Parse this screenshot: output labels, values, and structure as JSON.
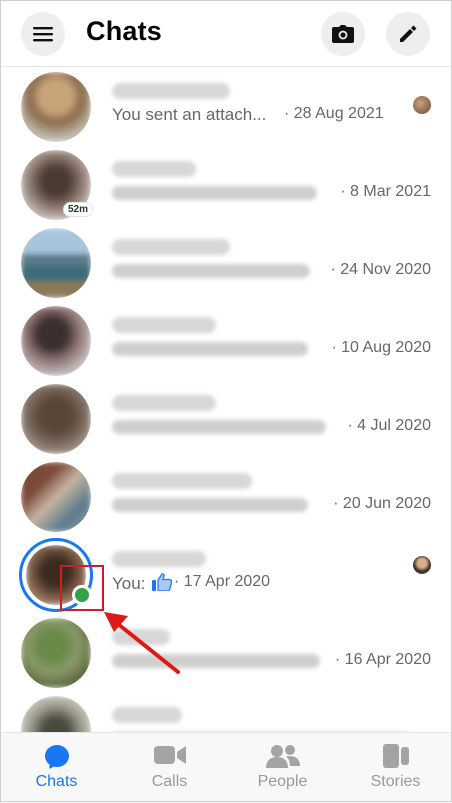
{
  "header": {
    "title": "Chats"
  },
  "chats": [
    {
      "preview": "You sent an attach...",
      "date": "· 28 Aug 2021",
      "time_badge": ""
    },
    {
      "preview": "",
      "date": "· 8 Mar 2021",
      "time_badge": "52m"
    },
    {
      "preview": "",
      "date": "· 24 Nov 2020",
      "time_badge": ""
    },
    {
      "preview": "",
      "date": "· 10 Aug 2020",
      "time_badge": ""
    },
    {
      "preview": "",
      "date": "· 4 Jul 2020",
      "time_badge": ""
    },
    {
      "preview": "",
      "date": "· 20 Jun 2020",
      "time_badge": ""
    },
    {
      "preview_prefix": "You:",
      "date": "· 17 Apr 2020",
      "time_badge": ""
    },
    {
      "preview": "",
      "date": "· 16 Apr 2020",
      "time_badge": ""
    },
    {
      "preview": "",
      "date": "",
      "time_badge": ""
    }
  ],
  "tabs": [
    {
      "label": "Chats",
      "icon": "chat-bubble-icon",
      "active": true
    },
    {
      "label": "Calls",
      "icon": "video-camera-icon",
      "active": false
    },
    {
      "label": "People",
      "icon": "people-icon",
      "active": false
    },
    {
      "label": "Stories",
      "icon": "stories-icon",
      "active": false
    }
  ],
  "colors": {
    "accent": "#1877f2",
    "online": "#31a24c",
    "annotation": "#d11f1f"
  }
}
